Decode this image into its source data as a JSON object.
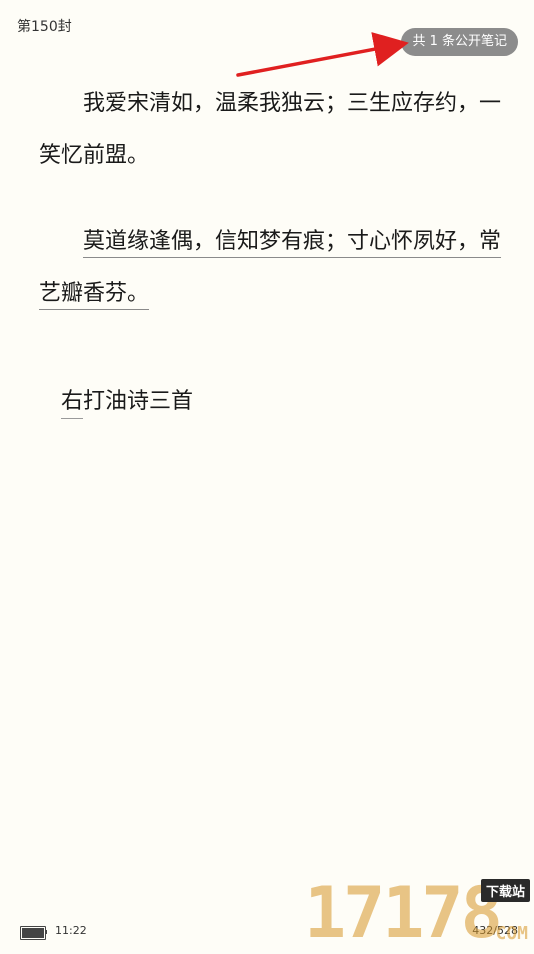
{
  "header": {
    "chapter_title": "第150封",
    "notes_button_label": "共 1 条公开笔记"
  },
  "content": {
    "paragraph_1": "我爱宋清如，温柔我独云；三生应存约，一笑忆前盟。",
    "paragraph_2": "莫道缘逢偶，信知梦有痕；寸心怀夙好，常艺瓣香芬。",
    "signature_first_char": "右",
    "signature_rest": "打油诗三首"
  },
  "status_bar": {
    "time": "11:22",
    "page": "432/528"
  },
  "watermark": {
    "digits": "17178",
    "tag": "下载站",
    "sub": "COM"
  },
  "colors": {
    "page_background": "#fefdf7",
    "notes_pill": "#8c8c8c",
    "annotation_arrow": "#e02020",
    "underline": "#8a8a8a"
  }
}
